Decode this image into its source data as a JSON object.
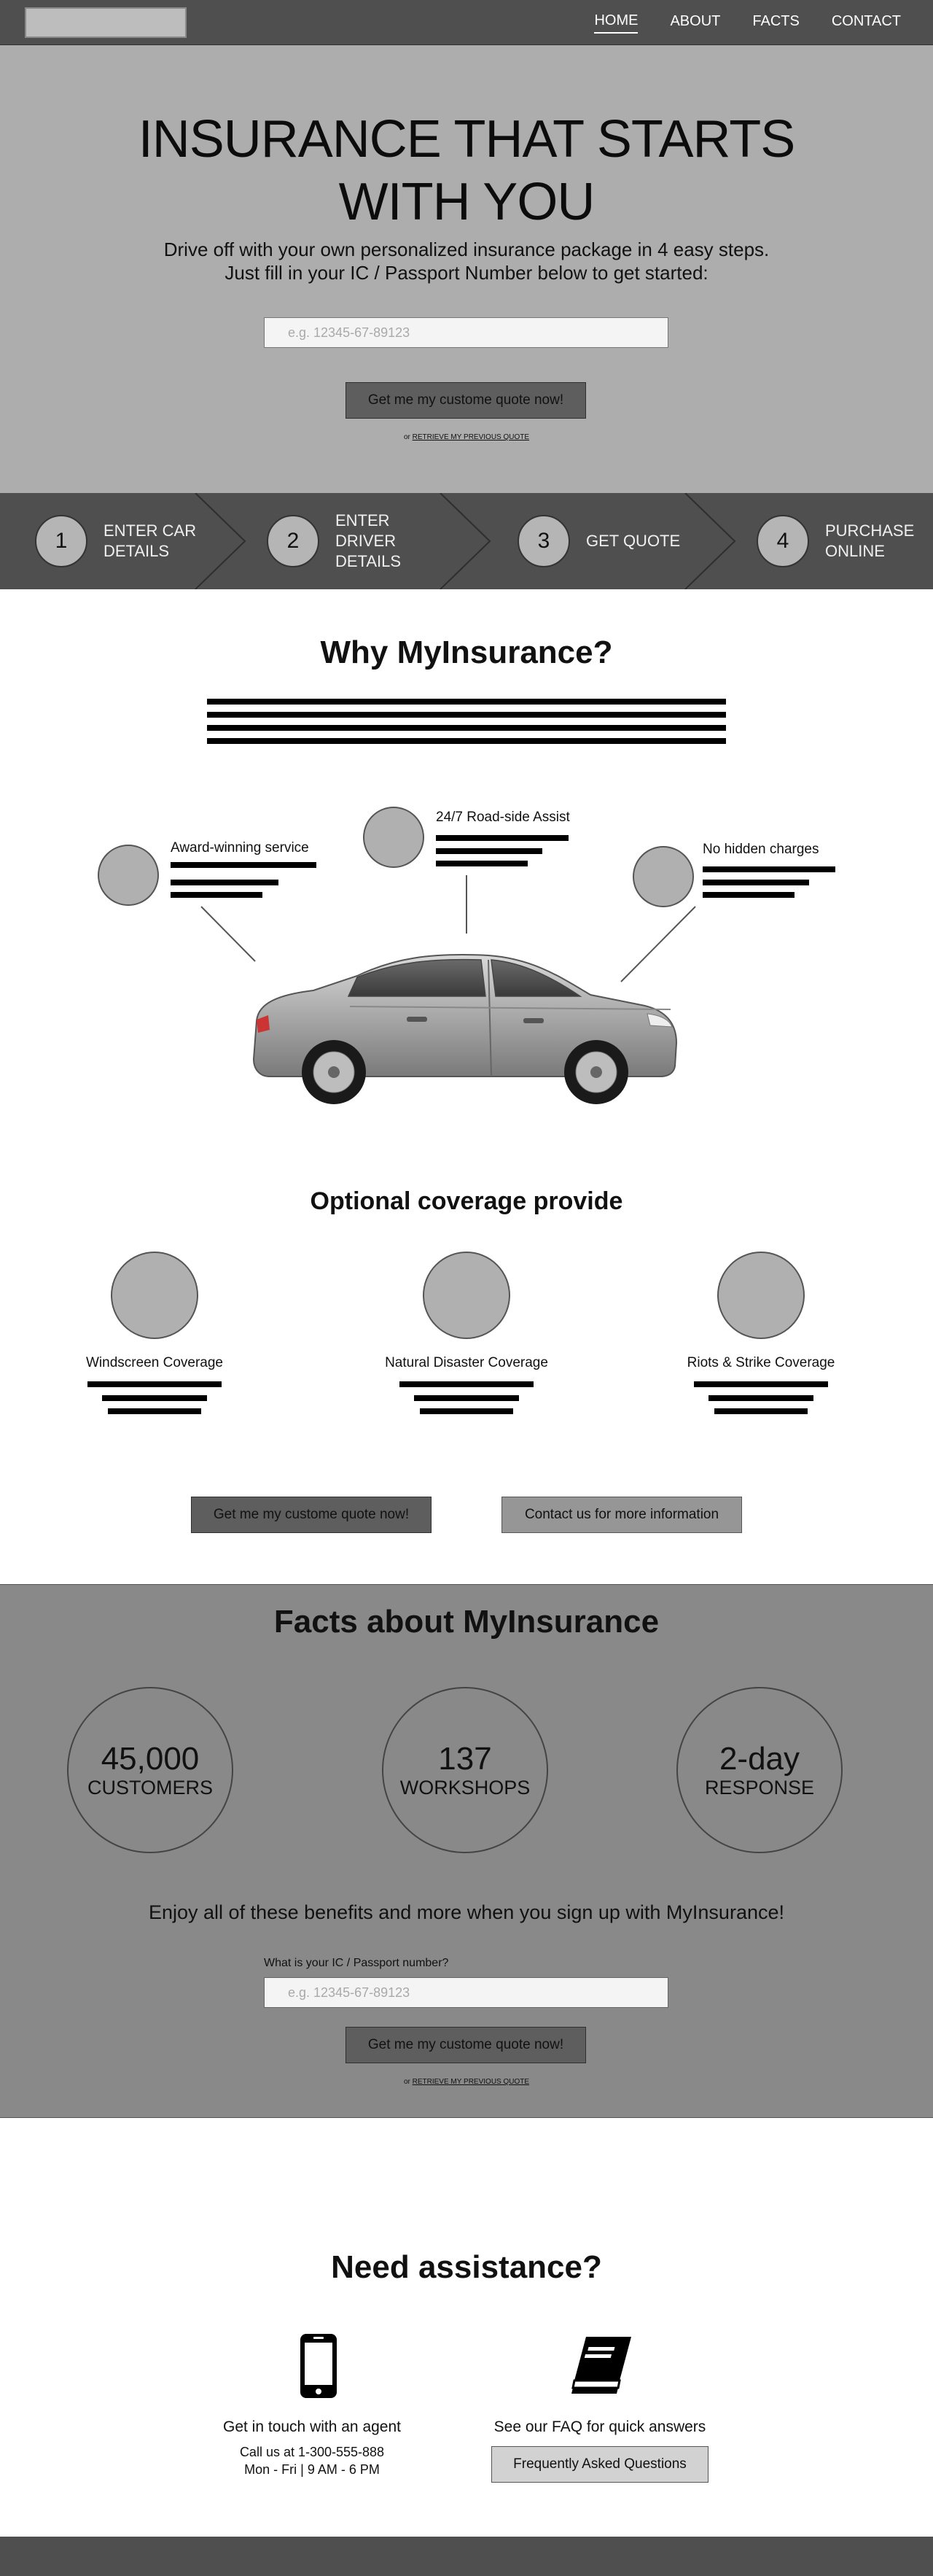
{
  "nav": {
    "links": [
      "HOME",
      "ABOUT",
      "FACTS",
      "CONTACT"
    ],
    "active": "HOME"
  },
  "hero": {
    "title_line1": "INSURANCE THAT STARTS",
    "title_line2": "WITH YOU",
    "subtitle_line1": "Drive off with your own personalized insurance package in 4 easy steps.",
    "subtitle_line2": "Just fill in your IC / Passport Number below to get started:",
    "input_placeholder": "e.g. 12345-67-89123",
    "cta_label": "Get me my custome quote now!",
    "retrieve_prefix": "or",
    "retrieve_link": "RETRIEVE MY PREVIOUS QUOTE"
  },
  "steps": [
    {
      "num": "1",
      "line1": "ENTER CAR",
      "line2": "DETAILS"
    },
    {
      "num": "2",
      "line1": "ENTER DRIVER",
      "line2": "DETAILS"
    },
    {
      "num": "3",
      "line1": "GET QUOTE",
      "line2": ""
    },
    {
      "num": "4",
      "line1": "PURCHASE",
      "line2": "ONLINE"
    }
  ],
  "why": {
    "title": "Why MyInsurance?",
    "features": [
      "Award-winning service",
      "24/7 Road-side Assist",
      "No hidden charges"
    ]
  },
  "optional": {
    "title": "Optional coverage provide",
    "items": [
      "Windscreen Coverage",
      "Natural Disaster Coverage",
      "Riots & Strike Coverage"
    ],
    "cta_primary": "Get me my custome quote now!",
    "cta_secondary": "Contact us for more information"
  },
  "facts": {
    "title": "Facts about MyInsurance",
    "stats": [
      {
        "value": "45,000",
        "label": "CUSTOMERS"
      },
      {
        "value": "137",
        "label": "WORKSHOPS"
      },
      {
        "value": "2-day",
        "label": "RESPONSE"
      }
    ],
    "subtitle": "Enjoy all of these benefits and more when you sign up with MyInsurance!",
    "question": "What is your IC / Passport number?",
    "input_placeholder": "e.g. 12345-67-89123",
    "cta_label": "Get me my custome quote now!",
    "retrieve_prefix": "or",
    "retrieve_link": "RETRIEVE MY PREVIOUS QUOTE"
  },
  "assist": {
    "title": "Need assistance?",
    "agent_label": "Get in touch with an agent",
    "agent_phone": "Call us at 1-300-555-888",
    "agent_hours": "Mon - Fri | 9 AM - 6 PM",
    "faq_label": "See our FAQ for quick answers",
    "faq_button": "Frequently Asked Questions",
    "icons": [
      "phone-icon",
      "book-icon"
    ]
  },
  "colors": {
    "nav_bg": "#4f4f4f",
    "hero_bg": "#adadad",
    "facts_bg": "#898989",
    "button_dark": "#5e5e5e"
  }
}
